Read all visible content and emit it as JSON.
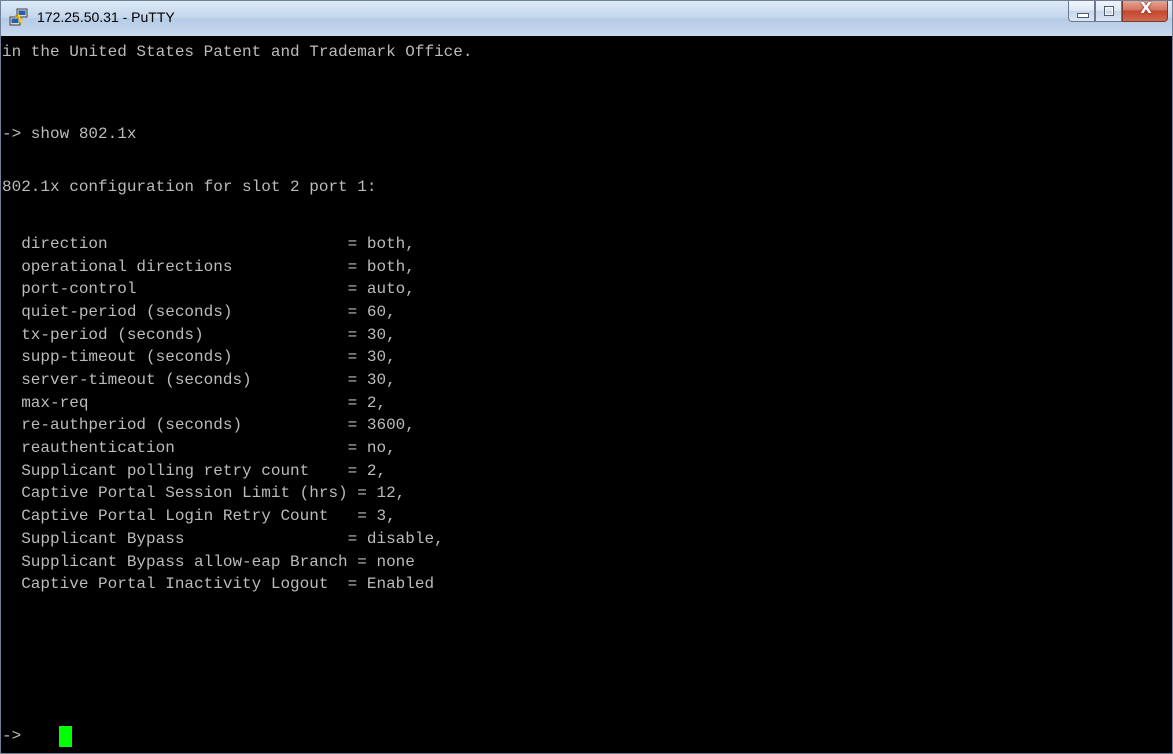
{
  "window": {
    "title": "172.25.50.31 - PuTTY",
    "icon": "putty-icon"
  },
  "caption_buttons": {
    "minimize": "minimize-icon",
    "maximize": "maximize-icon",
    "close": "close-icon",
    "close_glyph": "X"
  },
  "terminal": {
    "background": "#000000",
    "foreground": "#bbbbbb",
    "cursor_color": "#00ff00",
    "lines": [
      "in the United States Patent and Trademark Office.",
      "",
      "-> show 802.1x",
      "",
      "802.1x configuration for slot 2 port 1:",
      "",
      "  direction                         = both,",
      "  operational directions            = both,",
      "  port-control                      = auto,",
      "  quiet-period (seconds)            = 60,",
      "  tx-period (seconds)               = 30,",
      "  supp-timeout (seconds)            = 30,",
      "  server-timeout (seconds)          = 30,",
      "  max-req                           = 2,",
      "  re-authperiod (seconds)           = 3600,",
      "  reauthentication                  = no,",
      "  Supplicant polling retry count    = 2,",
      "  Captive Portal Session Limit (hrs) = 12,",
      "  Captive Portal Login Retry Count   = 3,",
      "  Supplicant Bypass                 = disable,",
      "  Supplicant Bypass allow-eap Branch = none",
      "  Captive Portal Inactivity Logout  = Enabled",
      "",
      "-> "
    ]
  }
}
